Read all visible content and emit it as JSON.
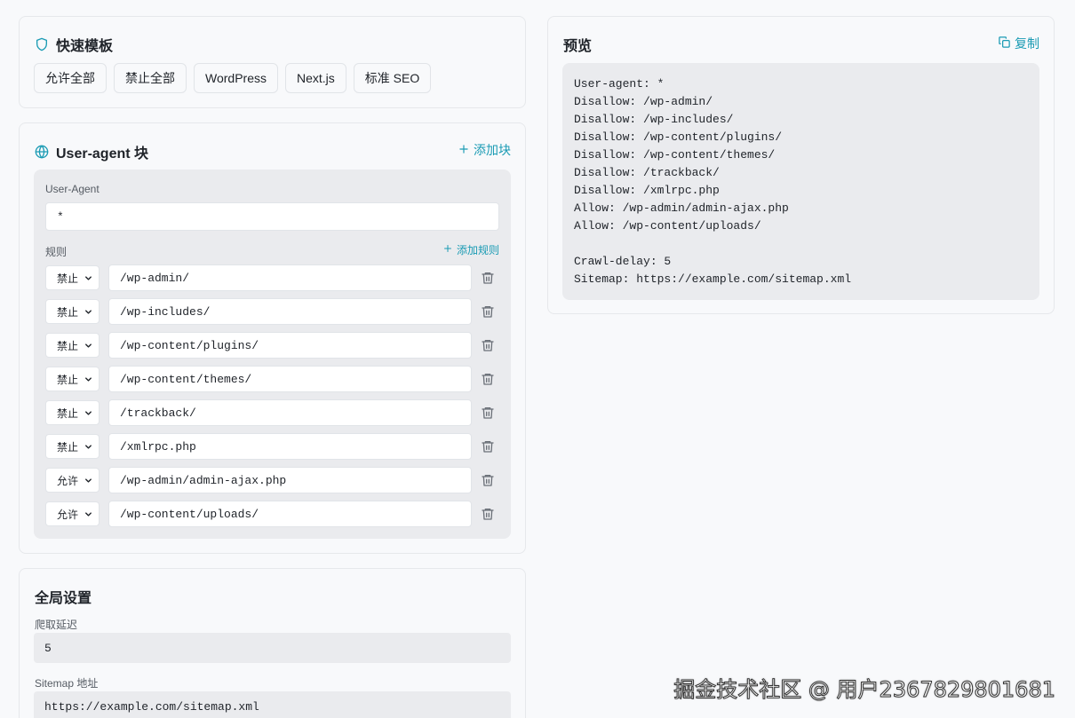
{
  "templates": {
    "title": "快速模板",
    "buttons": [
      "允许全部",
      "禁止全部",
      "WordPress",
      "Next.js",
      "标准 SEO"
    ]
  },
  "ua_block": {
    "title": "User-agent 块",
    "add_block_label": "添加块",
    "user_agent_label": "User-Agent",
    "user_agent_value": "*",
    "rules_label": "规则",
    "add_rule_label": "添加规则",
    "rules": [
      {
        "type": "禁止",
        "path": "/wp-admin/"
      },
      {
        "type": "禁止",
        "path": "/wp-includes/"
      },
      {
        "type": "禁止",
        "path": "/wp-content/plugins/"
      },
      {
        "type": "禁止",
        "path": "/wp-content/themes/"
      },
      {
        "type": "禁止",
        "path": "/trackback/"
      },
      {
        "type": "禁止",
        "path": "/xmlrpc.php"
      },
      {
        "type": "允许",
        "path": "/wp-admin/admin-ajax.php"
      },
      {
        "type": "允许",
        "path": "/wp-content/uploads/"
      }
    ]
  },
  "global": {
    "title": "全局设置",
    "crawl_delay_label": "爬取延迟",
    "crawl_delay_value": "5",
    "sitemap_label": "Sitemap 地址",
    "sitemap_value": "https://example.com/sitemap.xml"
  },
  "preview": {
    "title": "预览",
    "copy_label": "复制",
    "lines": [
      "User-agent: *",
      "Disallow: /wp-admin/",
      "Disallow: /wp-includes/",
      "Disallow: /wp-content/plugins/",
      "Disallow: /wp-content/themes/",
      "Disallow: /trackback/",
      "Disallow: /xmlrpc.php",
      "Allow: /wp-admin/admin-ajax.php",
      "Allow: /wp-content/uploads/",
      "",
      "Crawl-delay: 5",
      "Sitemap: https://example.com/sitemap.xml"
    ]
  },
  "watermark": "掘金技术社区 @ 用户2367829801681",
  "colors": {
    "accent": "#1a9bb4",
    "panel_bg": "#eaebee",
    "page_bg": "#f8f9fb"
  }
}
